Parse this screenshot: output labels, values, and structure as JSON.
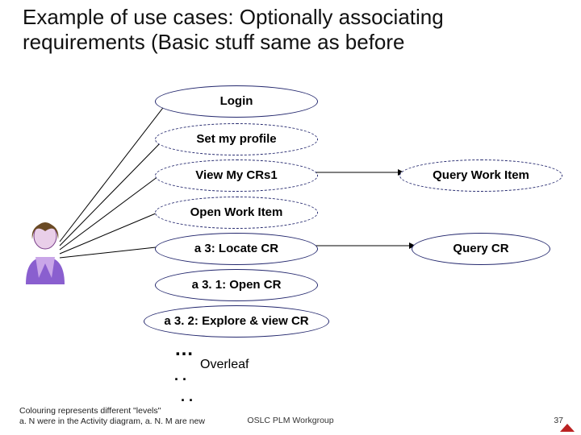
{
  "title": "Example of use cases: Optionally associating requirements (Basic stuff same as before",
  "nodes": {
    "login": "Login",
    "profile": "Set my profile",
    "viewcrs": "View My CRs1",
    "openwi": "Open Work Item",
    "locatecr": "a 3: Locate CR",
    "opencr": "a 3. 1: Open CR",
    "explorecr": "a 3. 2: Explore & view CR",
    "querywi": "Query Work Item",
    "querycr": "Query CR",
    "overleaf": "Overleaf",
    "dots1": "…",
    "dots2": ". .",
    "dots3": ". ."
  },
  "legend": {
    "l1": "Colouring represents different \"levels\"",
    "l2": "a. N were in the Activity diagram, a. N. M are new"
  },
  "footer": {
    "center": "OSLC PLM Workgroup",
    "page": "37"
  }
}
